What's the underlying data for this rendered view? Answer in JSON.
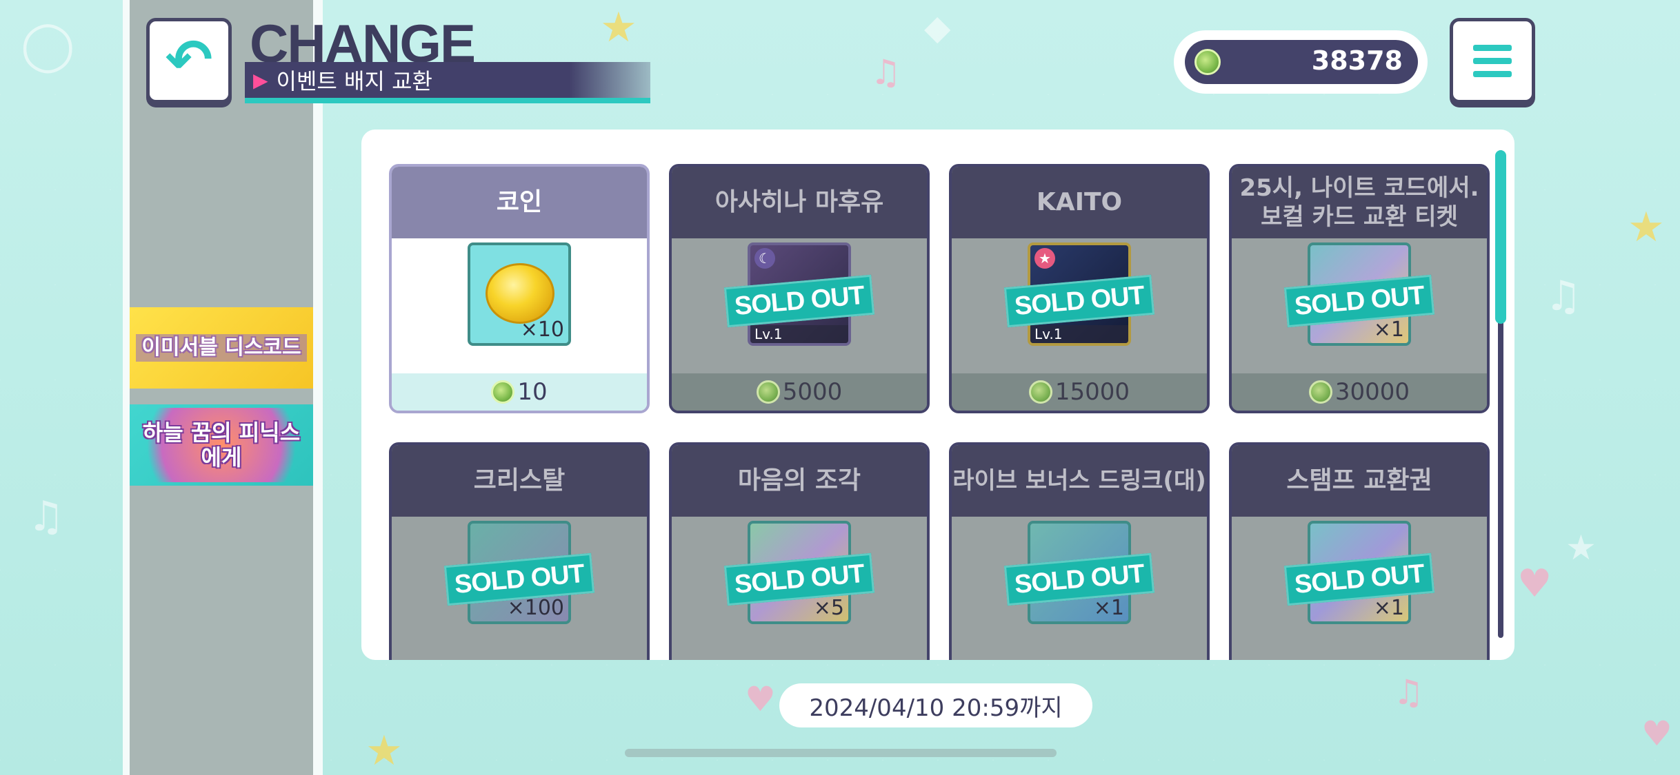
{
  "header": {
    "title": "CHANGE",
    "subtitle": "이벤트 배지 교환",
    "back_icon": "back-arrow-icon",
    "menu_icon": "hamburger-menu-icon"
  },
  "currency": {
    "icon": "event-badge-icon",
    "amount": "38378"
  },
  "sidebar": {
    "banners": [
      {
        "label": "이미서블 디스코드"
      },
      {
        "label": "하늘 꿈의 피닉스에게"
      }
    ]
  },
  "items": [
    {
      "name": "코인",
      "price": "10",
      "qty": "×10",
      "sold_out": false,
      "icon": "coin-icon"
    },
    {
      "name": "아사히나 마후유",
      "price": "5000",
      "level": "Lv.1",
      "sold_out": true,
      "sold_label": "SOLD OUT",
      "icon": "character-card-icon"
    },
    {
      "name": "KAITO",
      "price": "15000",
      "level": "Lv.1",
      "sold_out": true,
      "sold_label": "SOLD OUT",
      "icon": "character-card-icon"
    },
    {
      "name": "25시, 나이트 코드에서. 보컬 카드 교환 티켓",
      "price": "30000",
      "qty": "×1",
      "sold_out": true,
      "sold_label": "SOLD OUT",
      "icon": "ticket-icon"
    },
    {
      "name": "크리스탈",
      "qty": "×100",
      "sold_out": true,
      "sold_label": "SOLD OUT",
      "icon": "crystal-icon"
    },
    {
      "name": "마음의 조각",
      "qty": "×5",
      "sold_out": true,
      "sold_label": "SOLD OUT",
      "icon": "heart-piece-icon"
    },
    {
      "name": "라이브 보너스 드링크(대)",
      "qty": "×1",
      "sold_out": true,
      "sold_label": "SOLD OUT",
      "icon": "drink-can-icon"
    },
    {
      "name": "스탬프 교환권",
      "qty": "×1",
      "sold_out": true,
      "sold_label": "SOLD OUT",
      "icon": "stamp-ticket-icon"
    }
  ],
  "deadline": "2024/04/10 20:59까지",
  "colors": {
    "accent": "#2cc9c0",
    "navy": "#44436a",
    "sold_out": "#1bb7ab",
    "background": "#bfeee9"
  }
}
